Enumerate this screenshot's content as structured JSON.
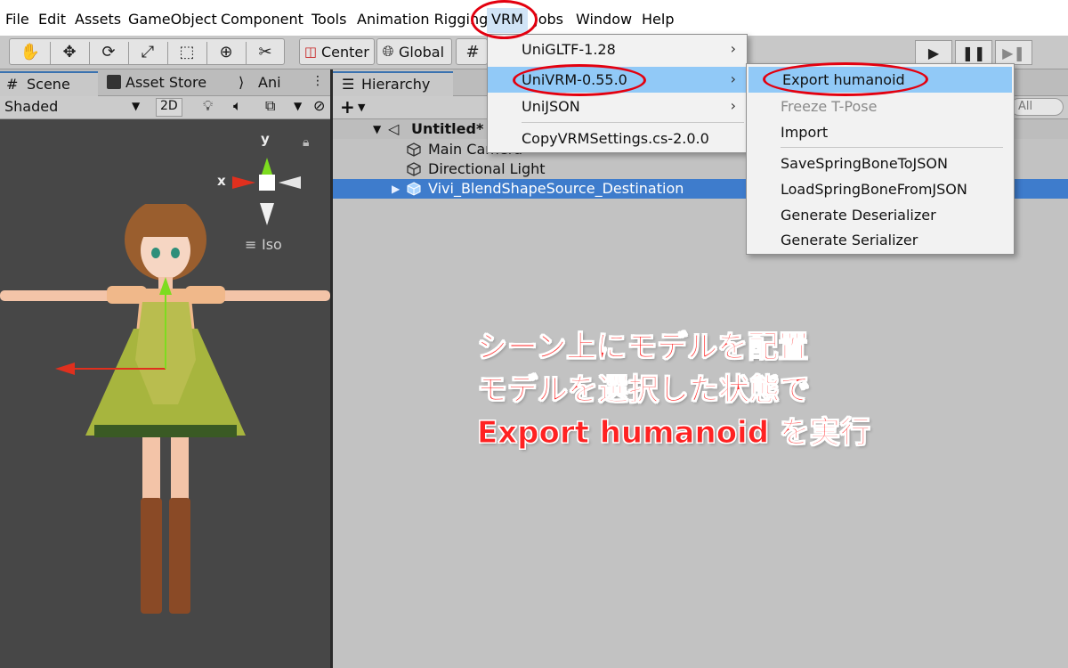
{
  "menubar": {
    "items": [
      "File",
      "Edit",
      "Assets",
      "GameObject",
      "Component",
      "Tools",
      "Animation Rigging",
      "VRM",
      "Jobs",
      "Window",
      "Help"
    ]
  },
  "toolbar": {
    "center_label": "Center",
    "global_label": "Global",
    "icons": [
      "hand-icon",
      "move-icon",
      "rotate-icon",
      "scale-icon",
      "rect-icon",
      "transform-icon",
      "custom-tool-icon"
    ],
    "play_icon": "▶",
    "pause_icon": "❚❚",
    "step_icon": "▶❚"
  },
  "scene_panel": {
    "tabs": [
      "Scene",
      "Asset Store",
      "Ani"
    ],
    "shading_mode": "Shaded",
    "mode_2d": "2D",
    "gizmo": {
      "y_label": "y",
      "x_label": "x",
      "projection": "Iso"
    }
  },
  "hierarchy": {
    "tab_label": "Hierarchy",
    "add_label": "+",
    "search_placeholder": "All",
    "scene_name": "Untitled*",
    "objects": [
      {
        "name": "Main Camera",
        "selected": false
      },
      {
        "name": "Directional Light",
        "selected": false
      },
      {
        "name": "Vivi_BlendShapeSource_Destination",
        "selected": true
      }
    ]
  },
  "vrm_menu": {
    "items": [
      {
        "label": "UniGLTF-1.28",
        "submenu": true
      },
      {
        "label": "UniVRM-0.55.0",
        "submenu": true,
        "highlighted": true
      },
      {
        "label": "UniJSON",
        "submenu": true
      },
      {
        "label": "CopyVRMSettings.cs-2.0.0",
        "submenu": false
      }
    ]
  },
  "univrm_submenu": {
    "items": [
      {
        "label": "Export humanoid",
        "highlighted": true
      },
      {
        "label": "Freeze T-Pose",
        "disabled": true
      },
      {
        "label": "Import"
      },
      {
        "label": "SaveSpringBoneToJSON"
      },
      {
        "label": "LoadSpringBoneFromJSON"
      },
      {
        "label": "Generate Deserializer"
      },
      {
        "label": "Generate Serializer"
      }
    ]
  },
  "annotation": {
    "lines": [
      "シーン上にモデルを配置",
      "モデルを選択した状態で",
      "Export humanoid を実行"
    ],
    "color": "#ff2222"
  },
  "colors": {
    "highlight": "#91c9f7",
    "selection": "#3e7ccc",
    "annotation_ring": "#e3000f",
    "scene_bg": "#474747"
  }
}
